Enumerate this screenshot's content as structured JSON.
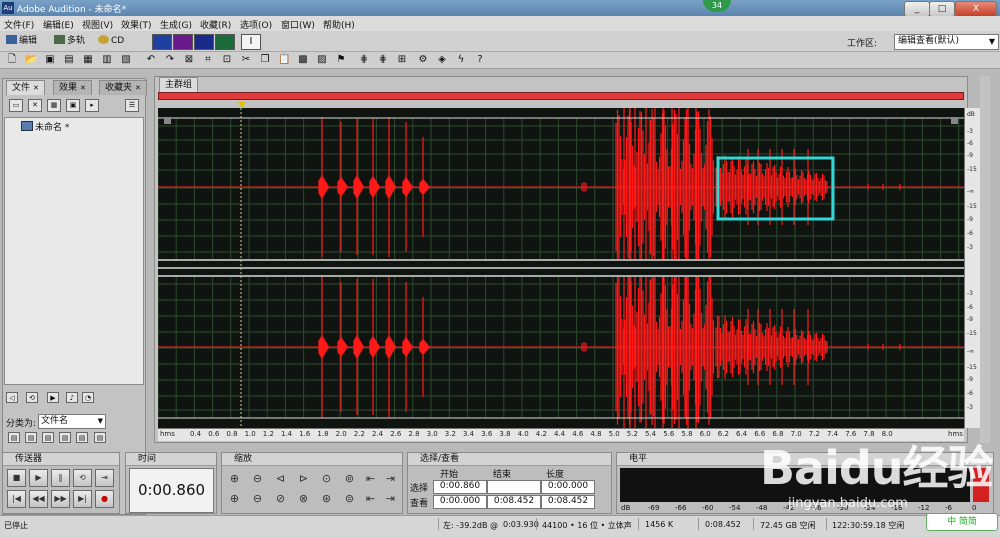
{
  "window": {
    "title": "Adobe Audition - 未命名*",
    "app_icon_text": "Au",
    "badge": "34",
    "btn_min": "_",
    "btn_max": "□",
    "btn_close": "X"
  },
  "menu": [
    "文件(F)",
    "编辑(E)",
    "视图(V)",
    "效果(T)",
    "生成(G)",
    "收藏(R)",
    "选项(O)",
    "窗口(W)",
    "帮助(H)"
  ],
  "views": {
    "edit": "编辑",
    "multitrack": "多轨",
    "cd": "CD"
  },
  "workspace": {
    "label": "工作区:",
    "value": "编辑查看(默认)"
  },
  "file_panel": {
    "tabs": [
      "文件",
      "效果",
      "收藏夹"
    ],
    "file_name": "未命名 *",
    "sort_label": "分类为:",
    "sort_value": "文件名"
  },
  "main_panel": {
    "tab": "主群组"
  },
  "db_ruler": [
    "dB",
    "-3",
    "-6",
    "-9",
    "-15",
    "-∞",
    "-15",
    "-9",
    "-6",
    "-3",
    "-3",
    "-6",
    "-9",
    "-15",
    "-∞",
    "-15",
    "-9",
    "-6",
    "-3"
  ],
  "timeline": {
    "start": "hms",
    "end": "hms",
    "ticks": [
      "0.4",
      "0.6",
      "0.8",
      "1.0",
      "1.2",
      "1.4",
      "1.6",
      "1.8",
      "2.0",
      "2.2",
      "2.4",
      "2.6",
      "2.8",
      "3.0",
      "3.2",
      "3.4",
      "3.6",
      "3.8",
      "4.0",
      "4.2",
      "4.4",
      "4.6",
      "4.8",
      "5.0",
      "5.2",
      "5.4",
      "5.6",
      "5.8",
      "6.0",
      "6.2",
      "6.4",
      "6.6",
      "6.8",
      "7.0",
      "7.2",
      "7.4",
      "7.6",
      "7.8",
      "8.0"
    ]
  },
  "transport": {
    "title": "传送器",
    "buttons": [
      "■",
      "▶",
      "‖",
      "⟲",
      "⇥",
      "|◀",
      "◀◀",
      "▶▶",
      "▶|",
      "●"
    ]
  },
  "time_panel": {
    "title": "时间",
    "value": "0:00.860"
  },
  "zoom_panel": {
    "title": "缩放"
  },
  "selection_panel": {
    "title": "选择/查看",
    "col_start": "开始",
    "col_end": "结束",
    "col_length": "长度",
    "row_select": "选择",
    "row_view": "查看",
    "select": {
      "start": "0:00.860",
      "end": "",
      "length": "0:00.000"
    },
    "view": {
      "start": "0:00.000",
      "end": "0:08.452",
      "length": "0:08.452"
    }
  },
  "level_panel": {
    "title": "电平",
    "ticks": [
      "dB",
      "-69",
      "-66",
      "-60",
      "-54",
      "-48",
      "-42",
      "-36",
      "-30",
      "-24",
      "-18",
      "-12",
      "-6",
      "0"
    ]
  },
  "status": {
    "state": "已停止",
    "left_level": "左: -39.2dB @",
    "cursor_time": "0:03.930",
    "format": "44100 • 16 位 • 立体声",
    "size": "1456 K",
    "duration": "0:08.452",
    "disk_space": "72.45 GB 空闲",
    "time_free": "122:30:59.18 空闲"
  },
  "watermark": {
    "brand": "Baidu经验",
    "url": "jingyan.baidu.com",
    "corner": "中 简简"
  },
  "colors": {
    "waveform": "#ff1a1a",
    "wave_bg": "#0f1410",
    "grid": "#2f4a2f",
    "selection_box": "#31d6d6"
  }
}
